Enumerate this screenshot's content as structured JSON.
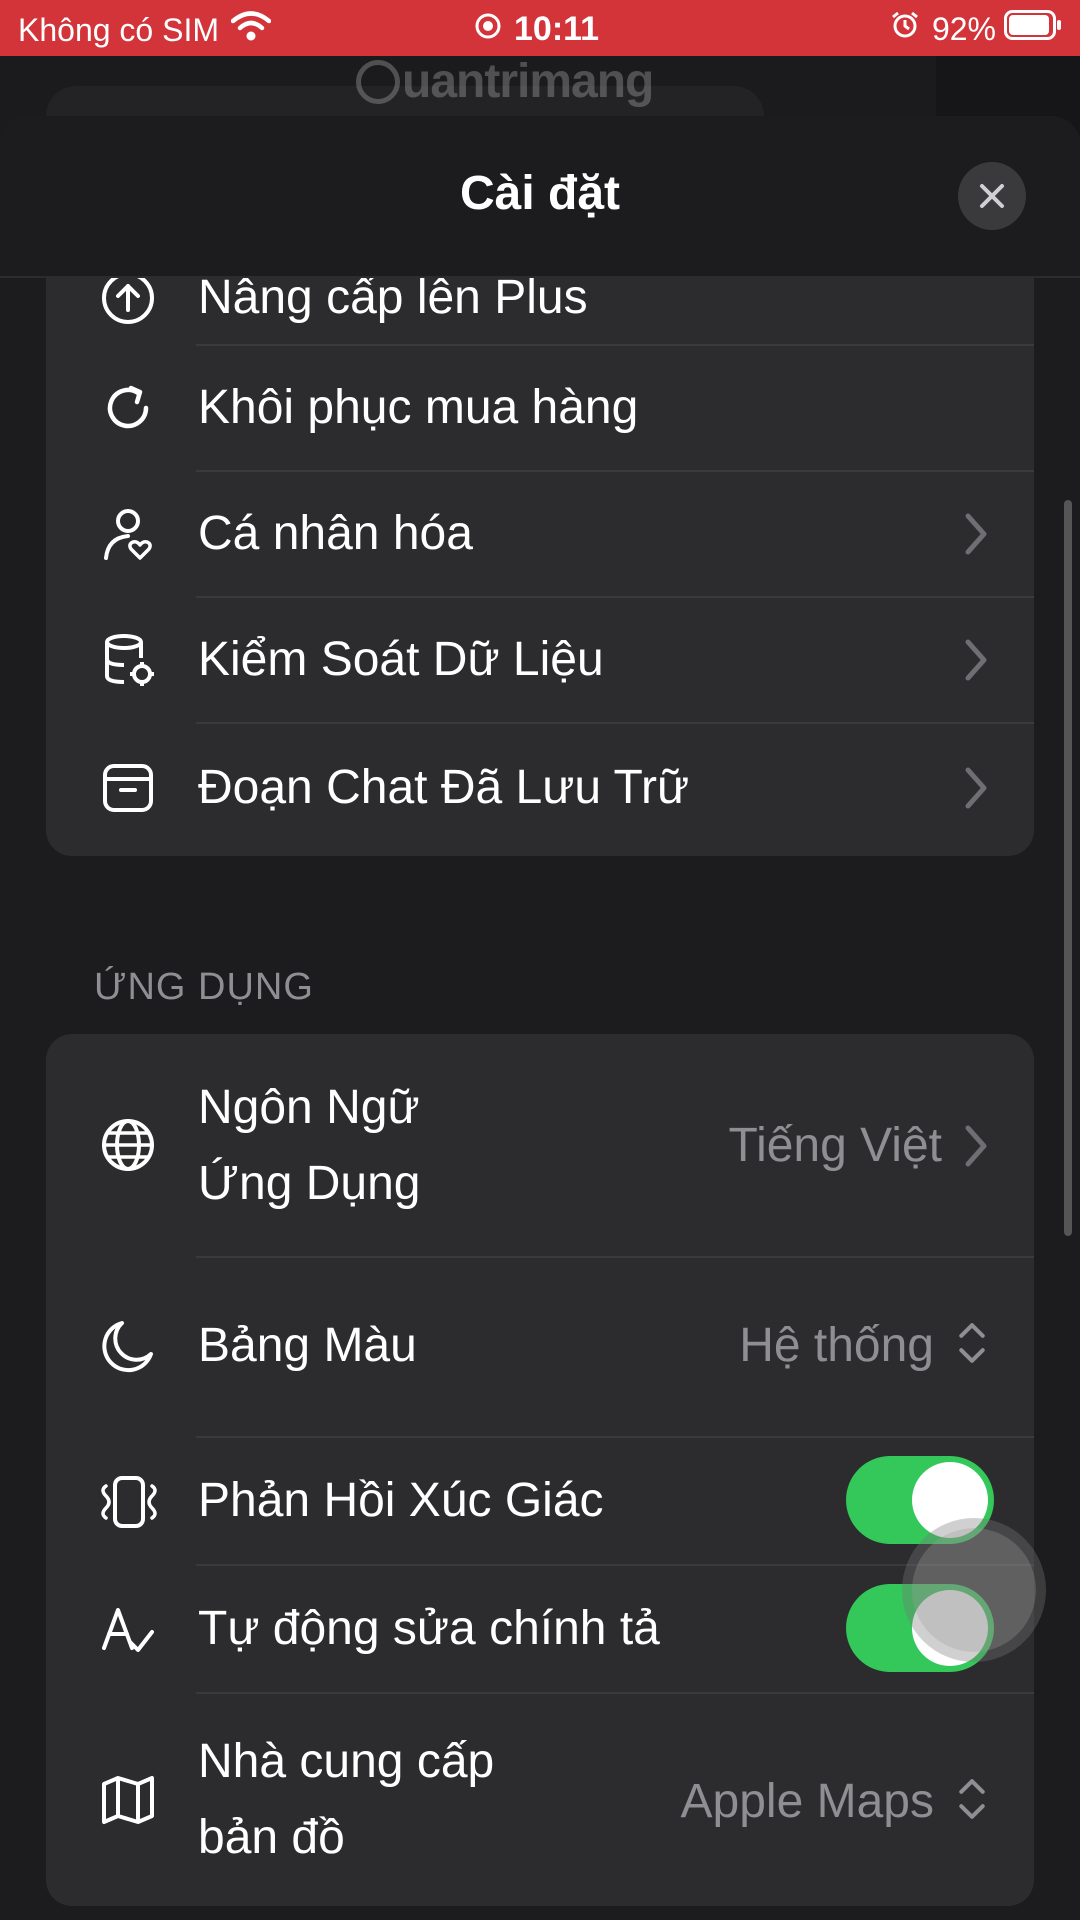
{
  "status_bar": {
    "carrier": "Không có SIM",
    "time": "10:11",
    "battery_percent": "92%"
  },
  "watermark": "uantrimang",
  "sheet": {
    "title": "Cài đặt"
  },
  "account_group": {
    "items": [
      {
        "label": "Nâng cấp lên Plus",
        "icon": "arrow-up-circle-icon"
      },
      {
        "label": "Khôi phục mua hàng",
        "icon": "refresh-icon"
      },
      {
        "label": "Cá nhân hóa",
        "icon": "person-heart-icon",
        "chevron": true
      },
      {
        "label": "Kiểm Soát Dữ Liệu",
        "icon": "database-gear-icon",
        "chevron": true
      },
      {
        "label": "Đoạn Chat Đã Lưu Trữ",
        "icon": "archive-box-icon",
        "chevron": true
      }
    ]
  },
  "app_section": {
    "header": "ỨNG DỤNG",
    "items": [
      {
        "label_line1": "Ngôn Ngữ",
        "label_line2": "Ứng Dụng",
        "value": "Tiếng Việt",
        "icon": "globe-icon"
      },
      {
        "label": "Bảng Màu",
        "value": "Hệ thống",
        "icon": "moon-icon"
      },
      {
        "label": "Phản Hồi Xúc Giác",
        "toggle_on": true,
        "icon": "haptic-phone-icon"
      },
      {
        "label": "Tự động sửa chính tả",
        "toggle_on": true,
        "icon": "spellcheck-icon"
      },
      {
        "label_line1": "Nhà cung cấp",
        "label_line2": "bản đồ",
        "value": "Apple Maps",
        "icon": "map-icon"
      }
    ]
  },
  "colors": {
    "status_bar_bg": "#d2343a",
    "toggle_on": "#34c759",
    "group_bg": "#2c2c2e",
    "secondary_text": "#8e8e93"
  }
}
